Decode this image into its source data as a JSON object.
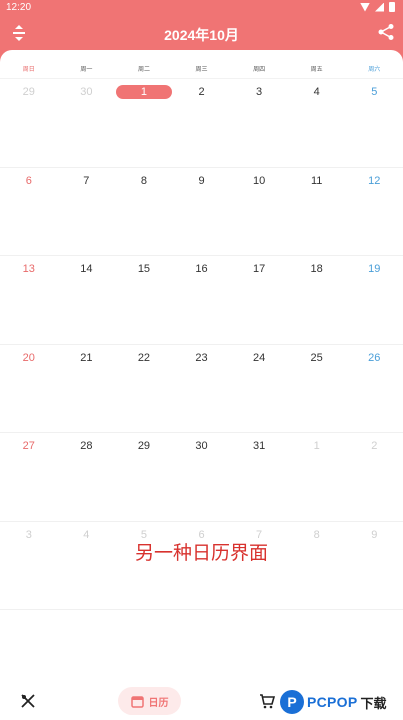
{
  "status_bar": {
    "time": "12:20"
  },
  "header": {
    "title": "2024年10月",
    "left_icon": "expand-collapse-icon",
    "right_icon": "share-icon"
  },
  "weekdays": [
    {
      "label": "周日",
      "type": "sun"
    },
    {
      "label": "周一",
      "type": ""
    },
    {
      "label": "周二",
      "type": ""
    },
    {
      "label": "周三",
      "type": ""
    },
    {
      "label": "周四",
      "type": ""
    },
    {
      "label": "周五",
      "type": ""
    },
    {
      "label": "周六",
      "type": "sat"
    }
  ],
  "calendar": [
    [
      "29",
      "30",
      "1",
      "2",
      "3",
      "4",
      "5"
    ],
    [
      "6",
      "7",
      "8",
      "9",
      "10",
      "11",
      "12"
    ],
    [
      "13",
      "14",
      "15",
      "16",
      "17",
      "18",
      "19"
    ],
    [
      "20",
      "21",
      "22",
      "23",
      "24",
      "25",
      "26"
    ],
    [
      "27",
      "28",
      "29",
      "30",
      "31",
      "1",
      "2"
    ],
    [
      "3",
      "4",
      "5",
      "6",
      "7",
      "8",
      "9"
    ]
  ],
  "faded_days": [
    [
      0,
      0
    ],
    [
      0,
      1
    ],
    [
      4,
      5
    ],
    [
      4,
      6
    ],
    [
      5,
      0
    ],
    [
      5,
      1
    ],
    [
      5,
      2
    ],
    [
      5,
      3
    ],
    [
      5,
      4
    ],
    [
      5,
      5
    ],
    [
      5,
      6
    ]
  ],
  "today": [
    0,
    2
  ],
  "overlay_caption": "另一种日历界面",
  "bottom_nav": {
    "left_icon": "fork-knife-icon",
    "center_label": "日历",
    "center_icon": "calendar-icon",
    "cart_icon": "cart-icon",
    "watermark_badge": "P",
    "watermark_text": "PCPOP",
    "watermark_suffix": "下载"
  },
  "colors": {
    "accent": "#f07474",
    "sunday": "#e86a6a",
    "saturday": "#4a9ed8",
    "faded": "#cfcfcf",
    "caption": "#d8322e"
  }
}
